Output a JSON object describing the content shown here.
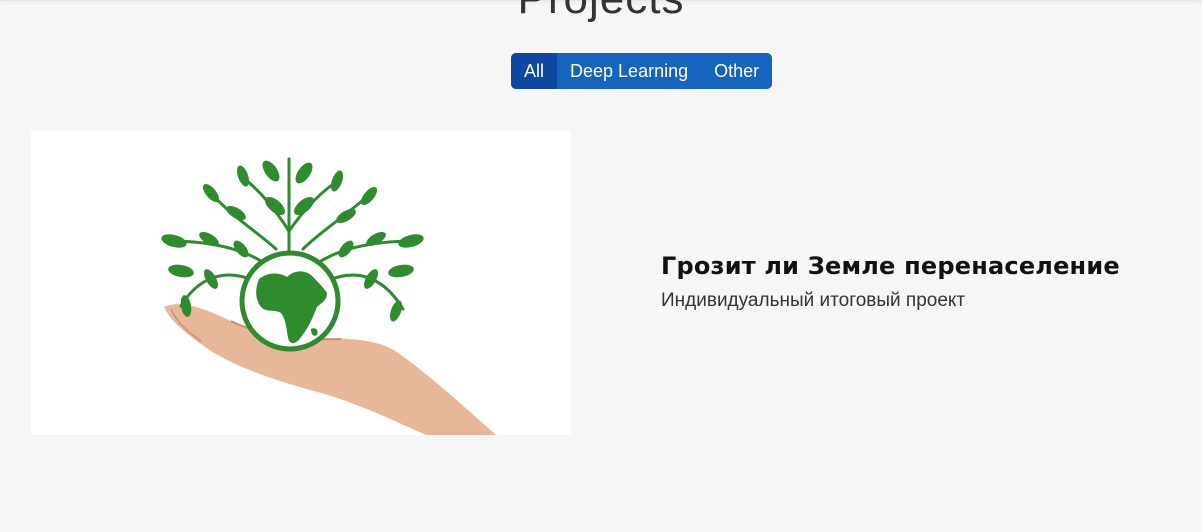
{
  "section": {
    "title": "Projects"
  },
  "filters": {
    "items": [
      {
        "label": "All",
        "active": true
      },
      {
        "label": "Deep Learning",
        "active": false
      },
      {
        "label": "Other",
        "active": false
      }
    ],
    "colors": {
      "button": "#1565c0",
      "active": "#0d47a1"
    }
  },
  "projects": [
    {
      "title": "Грозит ли Земле перенаселение",
      "subtitle": "Индивидуальный итоговый проект",
      "image_icon": "hand-holding-globe-tree-icon"
    }
  ],
  "colors": {
    "background": "#f6f6f6",
    "leaf_green": "#2e8b2e"
  }
}
